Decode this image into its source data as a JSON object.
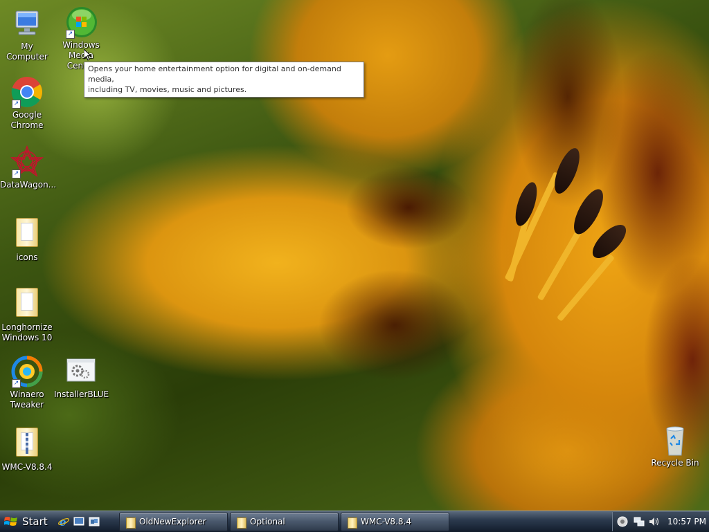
{
  "desktop": {
    "wallpaper": "lily-flower",
    "icons": [
      {
        "label_line1": "My Computer",
        "label_line2": "",
        "icon": "computer-icon",
        "shortcut": false
      },
      {
        "label_line1": "Windows",
        "label_line2": "Media Center",
        "icon": "windows-media-center-icon",
        "shortcut": true
      },
      {
        "label_line1": "Google",
        "label_line2": "Chrome",
        "icon": "chrome-icon",
        "shortcut": true
      },
      {
        "label_line1": "DataWagon...",
        "label_line2": "",
        "icon": "datawagon-icon",
        "shortcut": true
      },
      {
        "label_line1": "icons",
        "label_line2": "",
        "icon": "folder-icon",
        "shortcut": false
      },
      {
        "label_line1": "Longhornize",
        "label_line2": "Windows 10",
        "icon": "folder-icon",
        "shortcut": false
      },
      {
        "label_line1": "Winaero",
        "label_line2": "Tweaker",
        "icon": "winaero-icon",
        "shortcut": true
      },
      {
        "label_line1": "InstallerBLUE",
        "label_line2": "",
        "icon": "installer-icon",
        "shortcut": false
      },
      {
        "label_line1": "WMC-V8.8.4",
        "label_line2": "",
        "icon": "zip-folder-icon",
        "shortcut": false
      },
      {
        "label_line1": "Recycle Bin",
        "label_line2": "",
        "icon": "recycle-bin-icon",
        "shortcut": false
      }
    ]
  },
  "tooltip": {
    "line1": "Opens your home entertainment option for digital and on-demand media,",
    "line2": "including TV, movies, music and pictures."
  },
  "taskbar": {
    "start_label": "Start",
    "quick_launch": [
      "internet-explorer-icon",
      "show-desktop-icon",
      "switch-windows-icon"
    ],
    "tasks": [
      {
        "label": "OldNewExplorer"
      },
      {
        "label": "Optional"
      },
      {
        "label": "WMC-V8.8.4"
      }
    ],
    "tray": {
      "icons": [
        "media-icon",
        "network-icon",
        "volume-icon"
      ],
      "clock": "10:57 PM"
    }
  }
}
